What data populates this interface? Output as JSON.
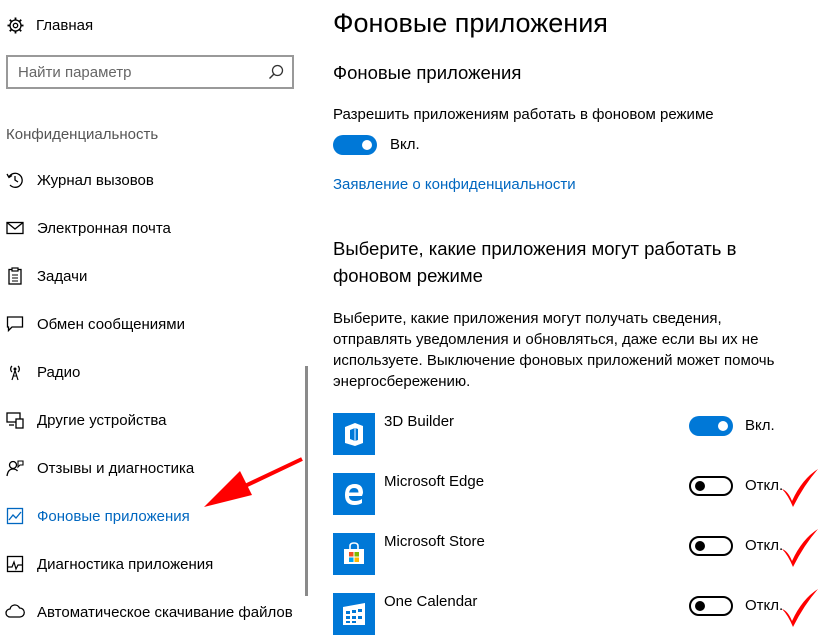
{
  "sidebar": {
    "home_label": "Главная",
    "search_placeholder": "Найти параметр",
    "section_title": "Конфиденциальность",
    "items": [
      {
        "label": "Журнал вызовов",
        "icon": "call-history-icon"
      },
      {
        "label": "Электронная почта",
        "icon": "mail-icon"
      },
      {
        "label": "Задачи",
        "icon": "tasks-icon"
      },
      {
        "label": "Обмен сообщениями",
        "icon": "messaging-icon"
      },
      {
        "label": "Радио",
        "icon": "radio-icon"
      },
      {
        "label": "Другие устройства",
        "icon": "devices-icon"
      },
      {
        "label": "Отзывы и диагностика",
        "icon": "feedback-icon"
      },
      {
        "label": "Фоновые приложения",
        "icon": "background-apps-icon",
        "active": true
      },
      {
        "label": "Диагностика приложения",
        "icon": "app-diagnostics-icon"
      },
      {
        "label": "Автоматическое скачивание файлов",
        "icon": "cloud-download-icon"
      }
    ]
  },
  "main": {
    "page_title": "Фоновые приложения",
    "section_title": "Фоновые приложения",
    "permission_label": "Разрешить приложениям работать в фоновом режиме",
    "permission_state": "Вкл.",
    "privacy_link": "Заявление о конфиденциальности",
    "choose_title": "Выберите, какие приложения могут работать в фоновом режиме",
    "choose_desc": "Выберите, какие приложения могут получать сведения, отправлять уведомления и обновляться, даже если вы их не используете. Выключение фоновых приложений может помочь энергосбережению.",
    "apps": [
      {
        "name": "3D Builder",
        "state": "Вкл.",
        "on": true
      },
      {
        "name": "Microsoft Edge",
        "state": "Откл.",
        "on": false
      },
      {
        "name": "Microsoft Store",
        "state": "Откл.",
        "on": false
      },
      {
        "name": "One Calendar",
        "state": "Откл.",
        "on": false
      }
    ]
  },
  "colors": {
    "accent": "#0078d7",
    "link": "#0067c0",
    "annotation": "#ff0000"
  }
}
